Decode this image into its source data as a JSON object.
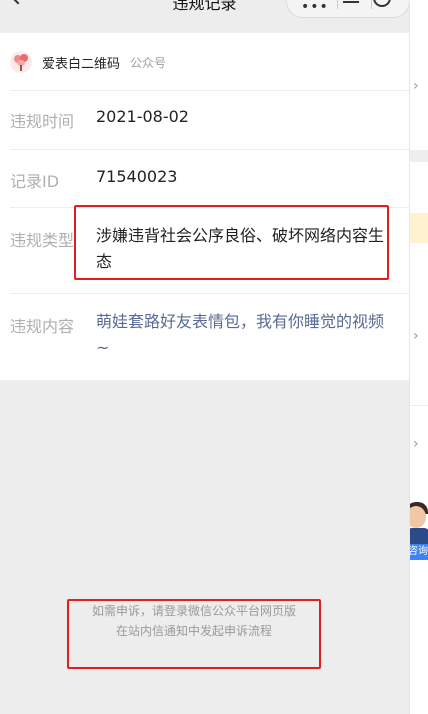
{
  "nav": {
    "title": "违规记录"
  },
  "account": {
    "name": "爱表白二维码",
    "type": "公众号"
  },
  "rows": [
    {
      "label": "违规时间",
      "value": "2021-08-02"
    },
    {
      "label": "记录ID",
      "value": "71540023"
    },
    {
      "label": "违规类型",
      "value": "涉嫌违背社会公序良俗、破坏网络内容生态"
    },
    {
      "label": "违规内容",
      "value": "萌娃套路好友表情包，我有你睡觉的视频~"
    }
  ],
  "footer": {
    "line1": "如需申诉，请登录微信公众平台网页版",
    "line2": "在站内信通知中发起申诉流程"
  },
  "side": {
    "tag": "咨询"
  },
  "colors": {
    "link": "#576b95",
    "highlight": "#e02020",
    "label": "#b0b0b0"
  }
}
